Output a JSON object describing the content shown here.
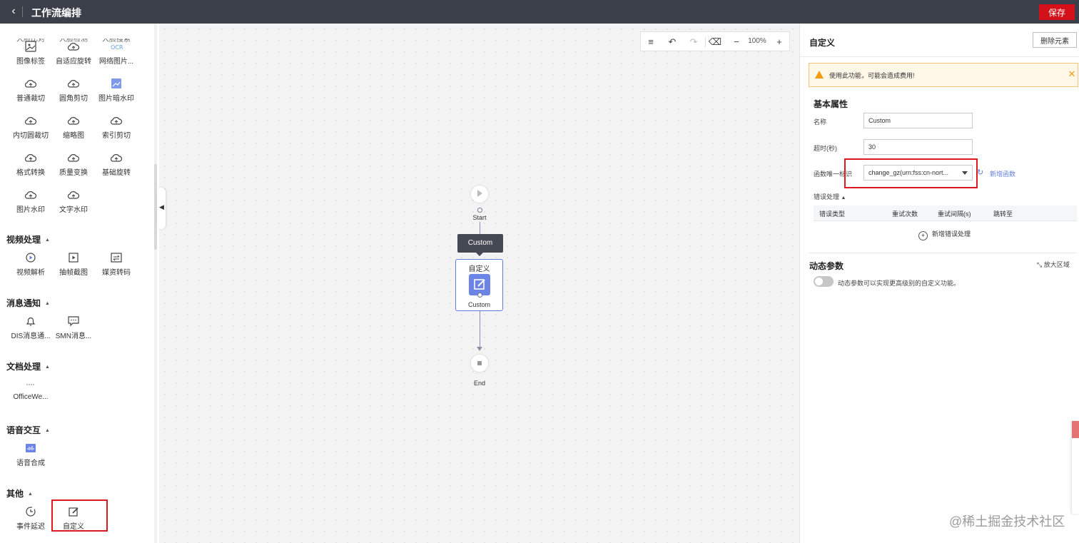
{
  "header": {
    "title": "工作流编排",
    "back_icon": "chevron-left-icon",
    "save_label": "保存",
    "save_color": "#d4111a"
  },
  "sidebar": {
    "cut_row": [
      "人脸比对",
      "人脸检测",
      "人脸搜索"
    ],
    "image_tools": [
      {
        "label": "图像标签",
        "icon": "image-icon"
      },
      {
        "label": "自适应旋转",
        "icon": "cloud-icon"
      },
      {
        "label": "网络图片...",
        "icon": "ocr-icon"
      },
      {
        "label": "普通裁切",
        "icon": "cloud-icon"
      },
      {
        "label": "圆角剪切",
        "icon": "cloud-icon"
      },
      {
        "label": "图片暗水印",
        "icon": "watermark-icon"
      },
      {
        "label": "内切圆裁切",
        "icon": "cloud-icon"
      },
      {
        "label": "缩略图",
        "icon": "cloud-icon"
      },
      {
        "label": "索引剪切",
        "icon": "cloud-icon"
      },
      {
        "label": "格式转换",
        "icon": "cloud-icon"
      },
      {
        "label": "质量变换",
        "icon": "cloud-icon"
      },
      {
        "label": "基础旋转",
        "icon": "cloud-icon"
      },
      {
        "label": "图片水印",
        "icon": "cloud-icon"
      },
      {
        "label": "文字水印",
        "icon": "cloud-icon"
      }
    ],
    "sections": [
      {
        "title": "视频处理",
        "items": [
          {
            "label": "视频解析",
            "icon": "video-parse-icon"
          },
          {
            "label": "抽帧截图",
            "icon": "frame-capture-icon"
          },
          {
            "label": "媒资转码",
            "icon": "transcode-icon"
          }
        ]
      },
      {
        "title": "消息通知",
        "items": [
          {
            "label": "DIS消息通...",
            "icon": "bell-icon"
          },
          {
            "label": "SMN消息...",
            "icon": "message-icon"
          }
        ]
      },
      {
        "title": "文档处理",
        "items": [
          {
            "label": "OfficeWe...",
            "icon": "document-icon"
          }
        ]
      },
      {
        "title": "语音交互",
        "items": [
          {
            "label": "语音合成",
            "icon": "voice-icon"
          }
        ]
      },
      {
        "title": "其他",
        "items": [
          {
            "label": "事件延迟",
            "icon": "clock-icon"
          },
          {
            "label": "自定义",
            "icon": "edit-icon"
          }
        ]
      }
    ]
  },
  "canvas": {
    "toolbar": {
      "zoom": "100%"
    },
    "nodes": {
      "start_label": "Start",
      "tooltip": "Custom",
      "custom_title": "自定义",
      "custom_name": "Custom",
      "end_label": "End",
      "node_color": "#6b84e6"
    }
  },
  "panel": {
    "title": "自定义",
    "delete_label": "删除元素",
    "warning": "使用此功能，可能会造成费用!",
    "basic_title": "基本属性",
    "name_label": "名称",
    "name_value": "Custom",
    "timeout_label": "超时(秒)",
    "timeout_value": "30",
    "function_label": "函数唯一标识",
    "function_value": "change_gz(urn:fss:cn-nort...",
    "new_function": "新增函数",
    "error_title": "错误处理",
    "error_columns": [
      "错误类型",
      "重试次数",
      "重试间隔(s)",
      "跳转至"
    ],
    "add_error": "新增错误处理",
    "dynamic_title": "动态参数",
    "expand_label": "放大区域",
    "dynamic_desc": "动态参数可以实现更高级别的自定义功能。",
    "highlight_color": "#e0181f",
    "link_color": "#5e7ce0"
  },
  "watermark": "@稀土掘金技术社区"
}
